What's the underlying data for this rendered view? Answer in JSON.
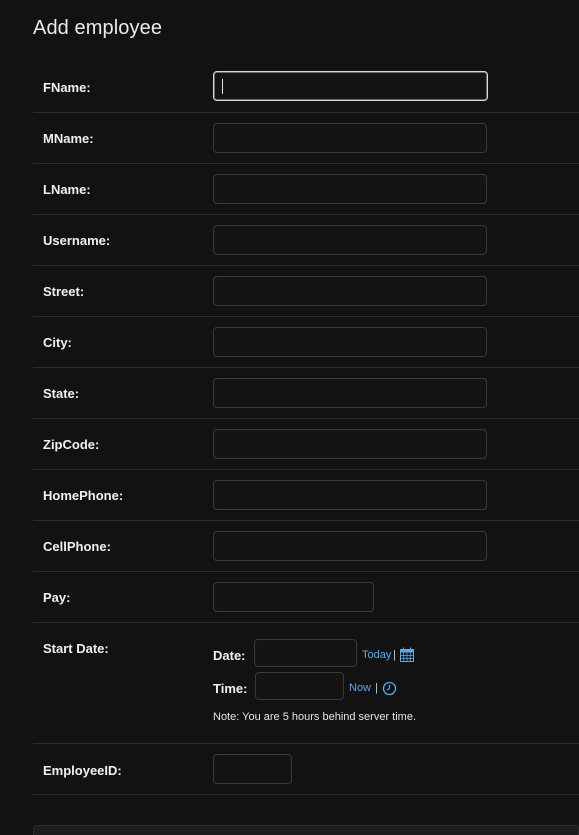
{
  "page": {
    "title": "Add employee"
  },
  "form": {
    "fields": [
      {
        "label": "FName:",
        "value": ""
      },
      {
        "label": "MName:",
        "value": ""
      },
      {
        "label": "LName:",
        "value": ""
      },
      {
        "label": "Username:",
        "value": ""
      },
      {
        "label": "Street:",
        "value": ""
      },
      {
        "label": "City:",
        "value": ""
      },
      {
        "label": "State:",
        "value": ""
      },
      {
        "label": "ZipCode:",
        "value": ""
      },
      {
        "label": "HomePhone:",
        "value": ""
      },
      {
        "label": "CellPhone:",
        "value": ""
      },
      {
        "label": "Pay:",
        "value": ""
      }
    ],
    "start_date": {
      "label": "Start Date:",
      "date_label": "Date:",
      "date_value": "",
      "today_link": "Today",
      "time_label": "Time:",
      "time_value": "",
      "now_link": "Now",
      "separator": "|",
      "note": "Note: You are 5 hours behind server time.",
      "calendar_icon": "calendar-icon",
      "clock_icon": "clock-icon"
    },
    "employee_id": {
      "label": "EmployeeID:",
      "value": ""
    }
  },
  "colors": {
    "background": "#121212",
    "link": "#5fa8e8",
    "border": "#3a3a3a"
  }
}
